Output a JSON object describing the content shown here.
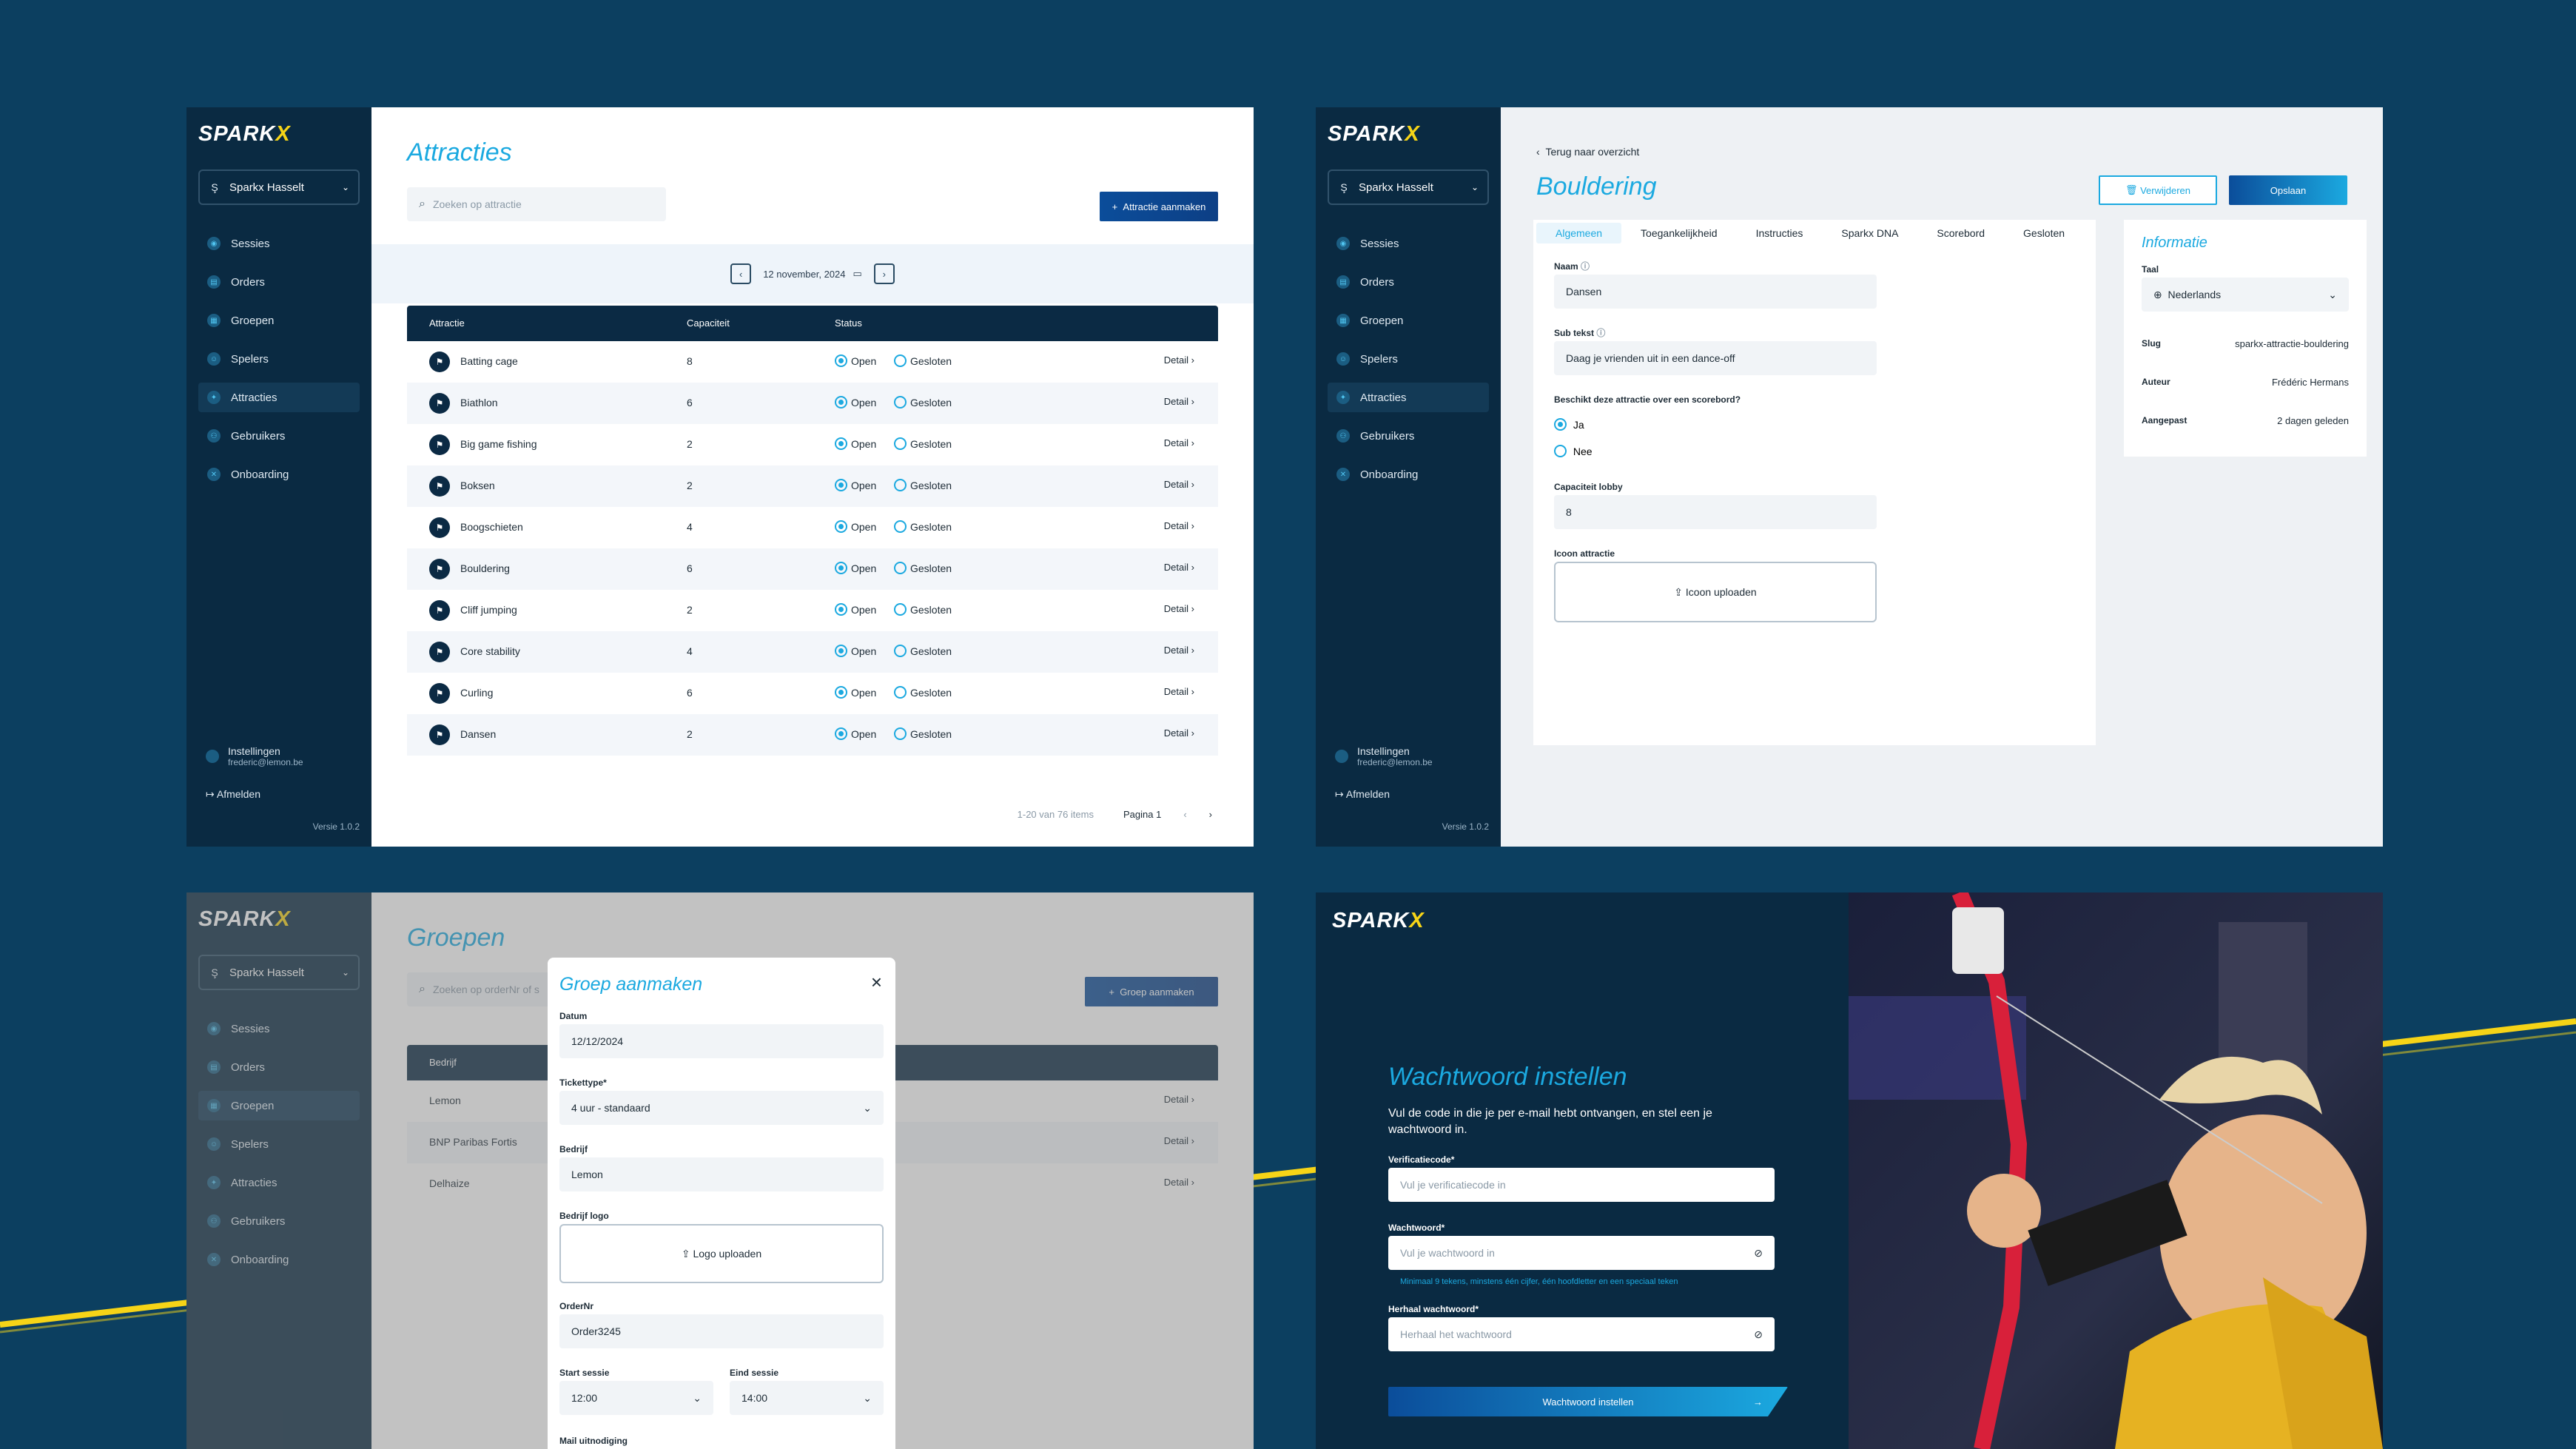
{
  "app": {
    "logo_main": "SPARK",
    "logo_x": "X",
    "location": "Sparkx Hasselt",
    "version": "Versie 1.0.2",
    "settings": "Instellingen",
    "email": "frederic@lemon.be",
    "logout": "Afmelden",
    "nav": [
      "Sessies",
      "Orders",
      "Groepen",
      "Spelers",
      "Attracties",
      "Gebruikers",
      "Onboarding"
    ]
  },
  "attracties": {
    "title": "Attracties",
    "search_placeholder": "Zoeken op attractie",
    "create_button": "Attractie aanmaken",
    "date": "12 november, 2024",
    "columns": [
      "Attractie",
      "Capaciteit",
      "Status"
    ],
    "open_label": "Open",
    "closed_label": "Gesloten",
    "detail_label": "Detail",
    "rows": [
      {
        "name": "Batting cage",
        "capacity": "8"
      },
      {
        "name": "Biathlon",
        "capacity": "6"
      },
      {
        "name": "Big game fishing",
        "capacity": "2"
      },
      {
        "name": "Boksen",
        "capacity": "2"
      },
      {
        "name": "Boogschieten",
        "capacity": "4"
      },
      {
        "name": "Bouldering",
        "capacity": "6"
      },
      {
        "name": "Cliff jumping",
        "capacity": "2"
      },
      {
        "name": "Core stability",
        "capacity": "4"
      },
      {
        "name": "Curling",
        "capacity": "6"
      },
      {
        "name": "Dansen",
        "capacity": "2"
      }
    ],
    "range": "1-20 van 76 items",
    "page": "Pagina 1"
  },
  "bouldering": {
    "back": "Terug naar overzicht",
    "title": "Bouldering",
    "delete": "Verwijderen",
    "save": "Opslaan",
    "tabs": [
      "Algemeen",
      "Toegankelijkheid",
      "Instructies",
      "Sparkx DNA",
      "Scorebord",
      "Gesloten"
    ],
    "name_label": "Naam",
    "name_value": "Dansen",
    "subtext_label": "Sub tekst",
    "subtext_value": "Daag je vrienden uit in een dance-off",
    "scoreboard_q": "Beschikt deze attractie over een scorebord?",
    "yes": "Ja",
    "no": "Nee",
    "capacity_label": "Capaciteit lobby",
    "capacity_value": "8",
    "icon_label": "Icoon attractie",
    "icon_upload": "Icoon uploaden",
    "info": {
      "title": "Informatie",
      "lang_label": "Taal",
      "lang_value": "Nederlands",
      "slug_label": "Slug",
      "slug_value": "sparkx-attractie-bouldering",
      "author_label": "Auteur",
      "author_value": "Frédéric Hermans",
      "modified_label": "Aangepast",
      "modified_value": "2 dagen geleden"
    }
  },
  "groepen": {
    "title": "Groepen",
    "search_placeholder": "Zoeken op orderNr of s",
    "create_button": "Groep aanmaken",
    "col": "Bedrijf",
    "rows": [
      "Lemon",
      "BNP Paribas Fortis",
      "Delhaize"
    ],
    "detail_label": "Detail",
    "modal": {
      "title": "Groep aanmaken",
      "datum_label": "Datum",
      "datum_value": "12/12/2024",
      "ticket_label": "Tickettype*",
      "ticket_value": "4 uur - standaard",
      "bedrijf_label": "Bedrijf",
      "bedrijf_value": "Lemon",
      "logo_label": "Bedrijf logo",
      "logo_upload": "Logo uploaden",
      "order_label": "OrderNr",
      "order_value": "Order3245",
      "start_label": "Start sessie",
      "start_value": "12:00",
      "end_label": "Eind sessie",
      "end_value": "14:00",
      "mail_label": "Mail uitnodiging"
    }
  },
  "wachtwoord": {
    "title": "Wachtwoord instellen",
    "desc": "Vul de code in die je per e-mail hebt ontvangen, en stel een je wachtwoord in.",
    "code_label": "Verificatiecode*",
    "code_ph": "Vul je verificatiecode in",
    "pw_label": "Wachtwoord*",
    "pw_ph": "Vul je wachtwoord in",
    "hint": "Minimaal 9 tekens, minstens één cijfer, één hoofdletter en een speciaal teken",
    "repeat_label": "Herhaal wachtwoord*",
    "repeat_ph": "Herhaal het wachtwoord",
    "submit": "Wachtwoord instellen"
  },
  "colors": {
    "bg": "#0c3f60",
    "sidebar": "#0a2a42",
    "accent": "#1ba9e0",
    "primary": "#0b4d9a",
    "yellow": "#f6d417"
  }
}
